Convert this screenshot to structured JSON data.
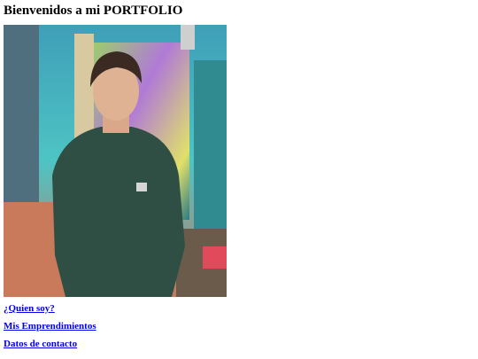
{
  "page": {
    "title": "Bienvenidos a mi PORTFOLIO"
  },
  "links": [
    {
      "label": "¿Quien soy?"
    },
    {
      "label": "Mis Emprendimientos"
    },
    {
      "label": "Datos de contacto"
    }
  ],
  "colors": {
    "link": "#0000ee",
    "sweater": "#2f4f45"
  }
}
